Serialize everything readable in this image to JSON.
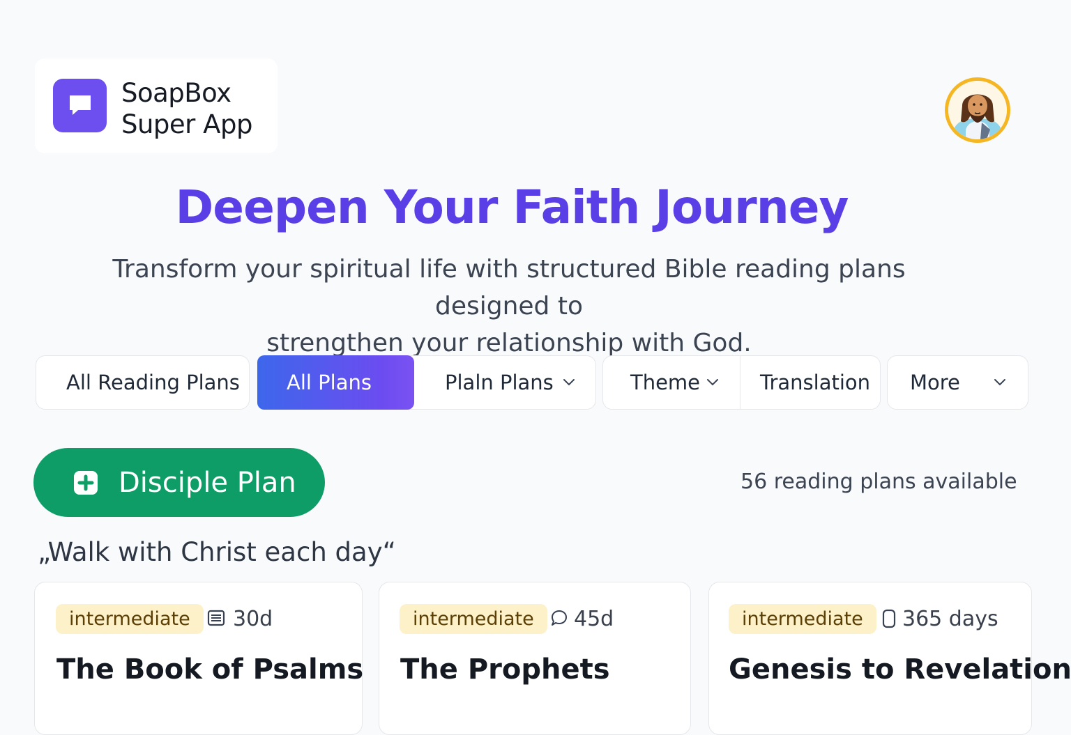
{
  "app": {
    "logo_line1": "SoapBox",
    "logo_line2": "Super App",
    "logo_icon": "chat-bubble-icon",
    "avatar_icon": "jesus-avatar-icon"
  },
  "hero": {
    "title": "Deepen Your Faith Journey",
    "subtitle_line1": "Transform your spiritual life with structured Bible reading plans designed to",
    "subtitle_line2": "strengthen your relationship with God."
  },
  "filters": {
    "all_reading_plans": "All Reading Plans",
    "all_plans": "All Plans",
    "plain_plans": "Plaln Plans",
    "theme": "Theme",
    "translation": "Translation",
    "more": "More"
  },
  "actions": {
    "disciple_plan": "Disciple Plan",
    "plan_count": "56 reading plans available"
  },
  "quote": "„Walk with Christ each day“",
  "cards": [
    {
      "level": "intermediate",
      "duration": "30d",
      "icon": "calendar-list-icon",
      "title": "The Book of Psalms"
    },
    {
      "level": "intermediate",
      "duration": "45d",
      "icon": "chat-bubble-icon",
      "title": "The Prophets"
    },
    {
      "level": "intermediate",
      "duration": "365 days",
      "icon": "phone-icon",
      "title": "Genesis to Revelation"
    }
  ],
  "colors": {
    "brand_purple": "#5b3fe6",
    "logo_purple": "#6d4ff0",
    "button_green": "#0f9d67",
    "badge_yellow": "#fdf1c9",
    "avatar_border": "#f5b624"
  }
}
